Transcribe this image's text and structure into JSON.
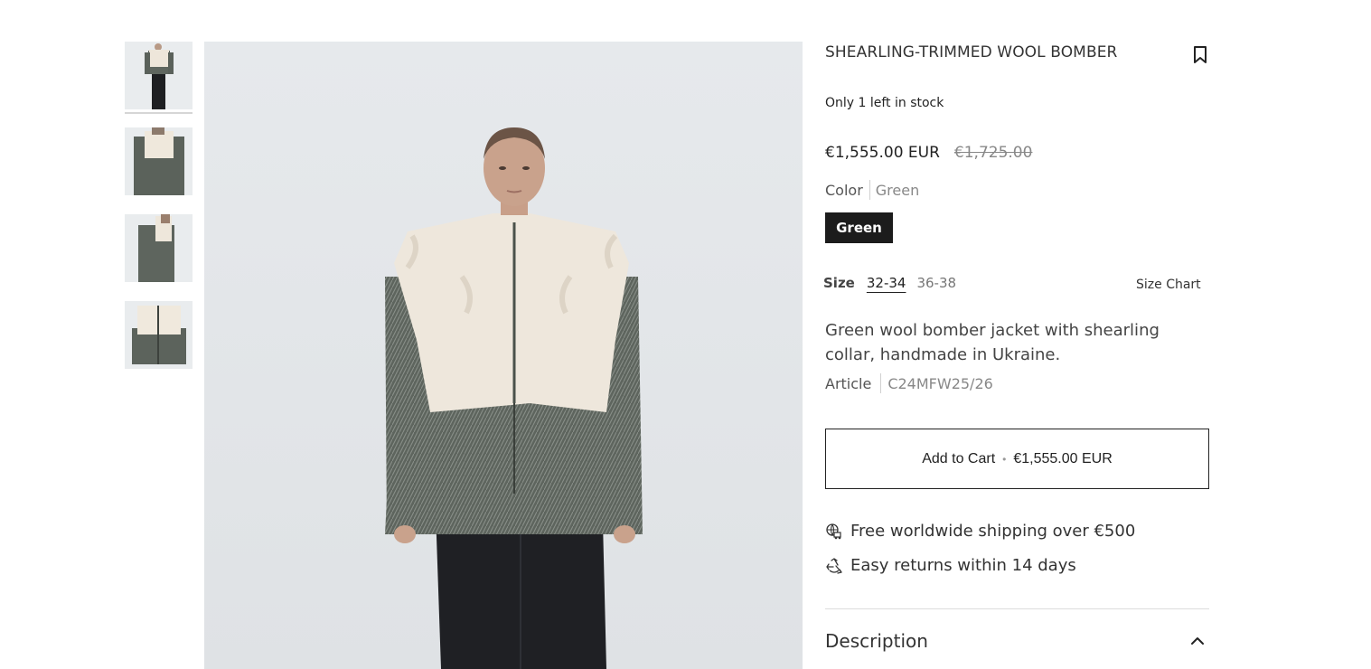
{
  "product": {
    "title": "SHEARLING-TRIMMED WOOL BOMBER",
    "stock_note": "Only 1 left in stock",
    "price_current": "€1,555.00 EUR",
    "price_original": "€1,725.00",
    "color_label": "Color",
    "color_value": "Green",
    "color_swatch": "Green",
    "size_label": "Size",
    "sizes": [
      "32-34",
      "36-38"
    ],
    "selected_size": "32-34",
    "size_chart_label": "Size Chart",
    "description": "Green wool bomber jacket with shearling collar, handmade in Ukraine.",
    "article_label": "Article",
    "article_value": "C24MFW25/26"
  },
  "cart": {
    "label": "Add to Cart",
    "separator": "•",
    "price": "€1,555.00 EUR"
  },
  "perks": [
    {
      "icon": "globe-truck-icon",
      "text": "Free worldwide shipping over €500"
    },
    {
      "icon": "recycle-icon",
      "text": "Easy returns within 14 days"
    }
  ],
  "accordion": {
    "title": "Description",
    "state": "expanded"
  },
  "icons": {
    "bookmark": "bookmark-icon",
    "chevron": "chevron-up-icon"
  },
  "colors": {
    "swatch_bg": "#1c1c1c",
    "text": "#222222",
    "muted": "#888888"
  }
}
